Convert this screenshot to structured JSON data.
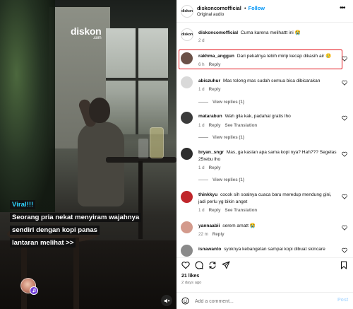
{
  "video": {
    "logo_main": "diskon",
    "logo_sub": ".com",
    "caption_lines": [
      "Viral!!!",
      "Seorang pria nekat menyiram wajahnya",
      "sendiri dengan kopi panas",
      "lantaran melihat >>"
    ],
    "avatar_icon": "creator-avatar",
    "badge_icon": "audio-badge-icon",
    "mute_icon": "mute-icon"
  },
  "header": {
    "logo_text": "diskon",
    "username": "diskoncomofficial",
    "separator": "•",
    "follow_label": "Follow",
    "audio": "Original audio",
    "more": "•••"
  },
  "caption_comment": {
    "logo_text": "diskon",
    "username": "diskoncomofficial",
    "text": "Cuma karena melihattt ini 😭",
    "time": "2 d"
  },
  "comments": [
    {
      "username": "rakhma_anggun",
      "text": "Dari pekatnya lebih mirip kecap dikasih air 🥲",
      "time": "6 h",
      "reply": "Reply",
      "translation": "",
      "view_replies": "",
      "avatar_color": "#6b5148"
    },
    {
      "username": "abiszuhur",
      "text": "Mas tolong mas sudah semua bisa dibicarakan",
      "time": "1 d",
      "reply": "Reply",
      "translation": "",
      "view_replies": "View replies (1)",
      "avatar_color": "#d9d9d9"
    },
    {
      "username": "matarabun",
      "text": "Wah gila kak, padahal gratis lho",
      "time": "1 d",
      "reply": "Reply",
      "translation": "See Translation",
      "view_replies": "View replies (1)",
      "avatar_color": "#3b3b3b"
    },
    {
      "username": "bryan_sngr",
      "text": "Mas, ga kasian apa sama kopi nya? Hah??? Segelas 25rebu lho",
      "time": "1 d",
      "reply": "Reply",
      "translation": "",
      "view_replies": "View replies (1)",
      "avatar_color": "#2d2d2d"
    },
    {
      "username": "thinkkyu",
      "text": "cocok sih soalnya cuaca baru meredup mendung gini, jadi perlu yg bikin anget",
      "time": "1 d",
      "reply": "Reply",
      "translation": "See Translation",
      "view_replies": "",
      "avatar_color": "#c0262b"
    },
    {
      "username": "yannaabii",
      "text": "serem amatt 😭",
      "time": "22 m",
      "reply": "Reply",
      "translation": "",
      "view_replies": "",
      "avatar_color": "#d39a8c"
    },
    {
      "username": "isnawanto",
      "text": "syoknya kebangetan sampai kopi dibuat skincare",
      "time": "",
      "reply": "",
      "translation": "",
      "view_replies": "",
      "avatar_color": "#8a8a8a"
    }
  ],
  "actions": {
    "icons": [
      "heart-icon",
      "comment-icon",
      "share-icon",
      "send-icon",
      "bookmark-icon"
    ],
    "likes": "21 likes",
    "date": "2 days ago"
  },
  "composer": {
    "placeholder": "Add a comment...",
    "post_label": "Post",
    "icon": "emoji-icon"
  },
  "colors": {
    "accent_blue": "#0095f6",
    "highlight_red": "#e4141b",
    "caption_cyan": "#2fd3ff",
    "muted_text": "#737373"
  }
}
